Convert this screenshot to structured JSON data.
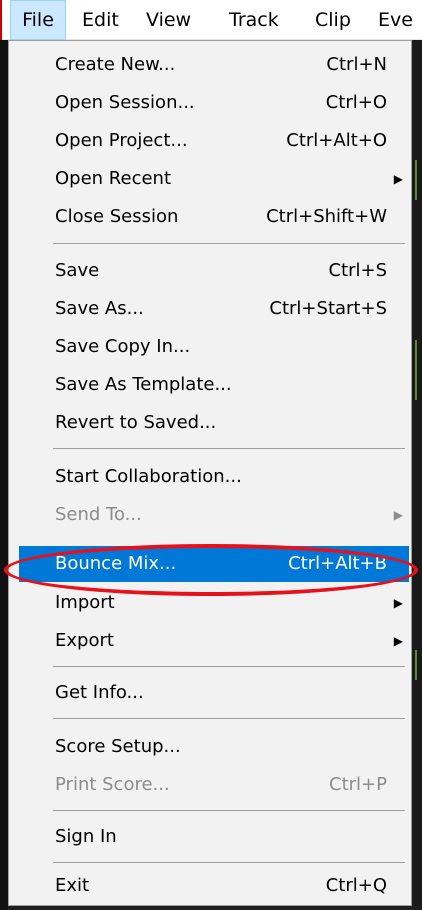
{
  "menubar": {
    "items": [
      "File",
      "Edit",
      "View",
      "Track",
      "Clip",
      "Eve"
    ]
  },
  "file_menu": {
    "items": [
      {
        "label": "Create New...",
        "shortcut": "Ctrl+N"
      },
      {
        "label": "Open Session...",
        "shortcut": "Ctrl+O"
      },
      {
        "label": "Open Project...",
        "shortcut": "Ctrl+Alt+O"
      },
      {
        "label": "Open Recent",
        "submenu": "▶"
      },
      {
        "label": "Close Session",
        "shortcut": "Ctrl+Shift+W"
      },
      {
        "label": "Save",
        "shortcut": "Ctrl+S"
      },
      {
        "label": "Save As...",
        "shortcut": "Ctrl+Start+S"
      },
      {
        "label": "Save Copy In..."
      },
      {
        "label": "Save As Template..."
      },
      {
        "label": "Revert to Saved..."
      },
      {
        "label": "Start Collaboration..."
      },
      {
        "label": "Send To...",
        "submenu": "▶"
      },
      {
        "label": "Bounce Mix...",
        "shortcut": "Ctrl+Alt+B"
      },
      {
        "label": "Import",
        "submenu": "▶"
      },
      {
        "label": "Export",
        "submenu": "▶"
      },
      {
        "label": "Get Info..."
      },
      {
        "label": "Score Setup..."
      },
      {
        "label": "Print Score...",
        "shortcut": "Ctrl+P"
      },
      {
        "label": "Sign In"
      },
      {
        "label": "Exit",
        "shortcut": "Ctrl+Q"
      }
    ]
  },
  "colors": {
    "highlight": "#0078d7",
    "annotation_ring": "#e8101a",
    "disabled_text": "#8c8c8c",
    "menu_background": "#f2f2f2"
  }
}
